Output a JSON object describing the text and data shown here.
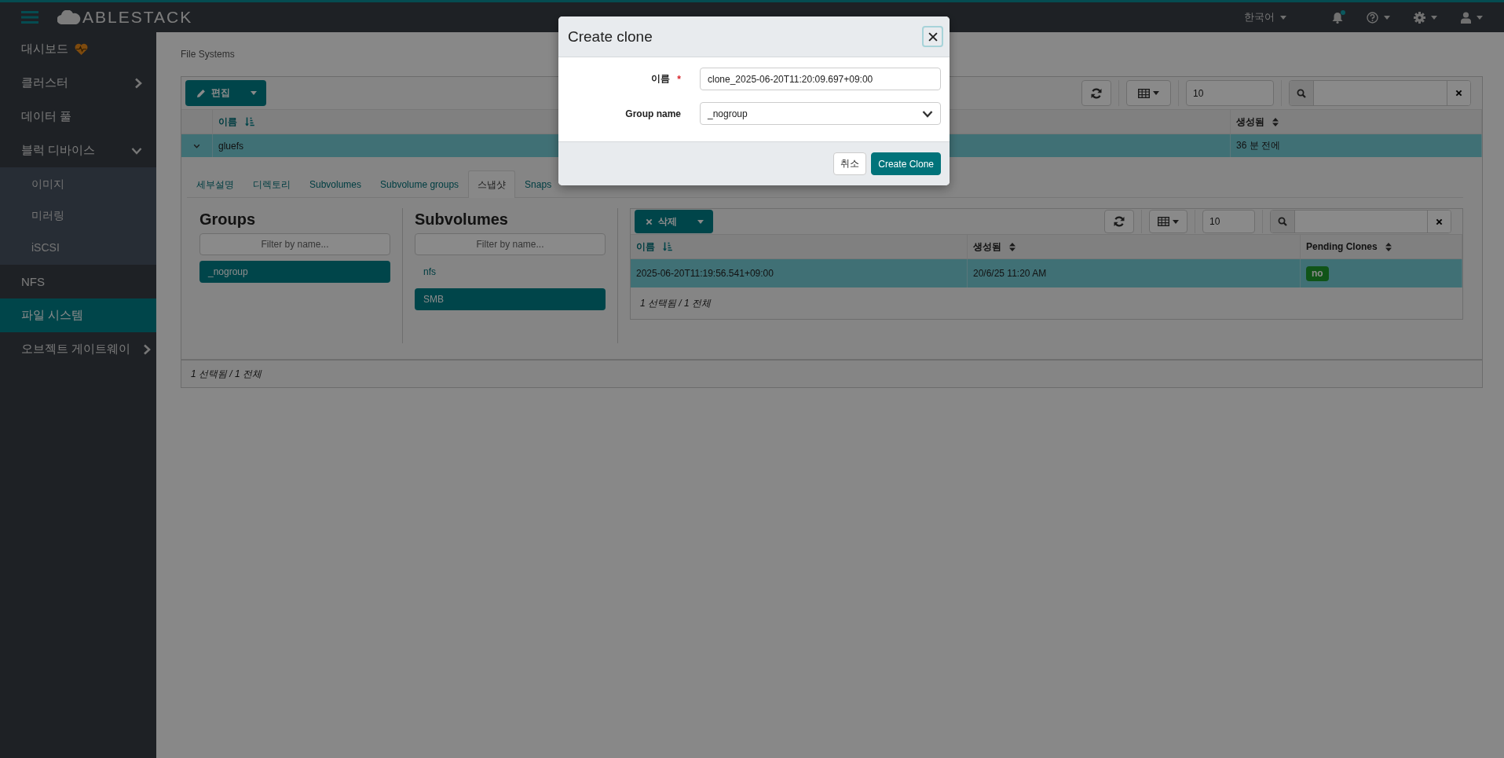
{
  "topbar": {
    "logo": "ABLESTACK",
    "language": "한국어",
    "notifications_unread": true
  },
  "sidebar": {
    "items": [
      {
        "label": "대시보드",
        "kind": "status",
        "selected": false
      },
      {
        "label": "클러스터",
        "kind": "menu",
        "selected": false,
        "expanded": false
      },
      {
        "label": "데이터 풀",
        "kind": "link",
        "selected": false
      },
      {
        "label": "블럭 디바이스",
        "kind": "menu",
        "selected": false,
        "expanded": true,
        "children": [
          {
            "label": "이미지",
            "selected": false
          },
          {
            "label": "미러링",
            "selected": false
          },
          {
            "label": "iSCSI",
            "selected": false
          }
        ]
      },
      {
        "label": "NFS",
        "kind": "link",
        "selected": false
      },
      {
        "label": "파일 시스템",
        "kind": "link",
        "selected": true
      },
      {
        "label": "오브젝트 게이트웨이",
        "kind": "menu",
        "selected": false,
        "expanded": false
      }
    ]
  },
  "breadcrumb": "File Systems",
  "file_systems": {
    "edit_button": "편집",
    "page_size": "10",
    "columns": [
      {
        "label": "이름",
        "sorted": true
      },
      {
        "label": "생성됨",
        "sorted": false
      }
    ],
    "rows": [
      {
        "cells": [
          "gluefs",
          "36 분 전에"
        ],
        "selected": true,
        "expanded": true
      }
    ],
    "footer": "1 선택됨 / 1 전체"
  },
  "detail": {
    "tabs": [
      {
        "label": "세부설명",
        "selected": false
      },
      {
        "label": "디렉토리",
        "selected": false
      },
      {
        "label": "Subvolumes",
        "selected": false
      },
      {
        "label": "Subvolume groups",
        "selected": false
      },
      {
        "label": "스냅샷",
        "selected": true
      },
      {
        "label": "Snaps",
        "selected": false
      }
    ],
    "groups": {
      "title": "Groups",
      "placeholder": "Filter by name...",
      "items": [
        {
          "label": "_nogroup",
          "selected": true
        }
      ]
    },
    "subvolumes": {
      "title": "Subvolumes",
      "placeholder": "Filter by name...",
      "items": [
        {
          "label": "nfs",
          "selected": false
        },
        {
          "label": "SMB",
          "selected": true
        }
      ]
    },
    "snapshots": {
      "delete_button": "삭제",
      "page_size": "10",
      "columns": [
        {
          "label": "이름",
          "sorted": true
        },
        {
          "label": "생성됨",
          "sorted": false
        },
        {
          "label": "Pending Clones",
          "sorted": false
        }
      ],
      "rows": [
        {
          "cells": [
            "2025-06-20T11:19:56.541+09:00",
            "20/6/25 11:20 AM"
          ],
          "pending_clones": "no",
          "selected": true
        }
      ],
      "footer": "1 선택됨 / 1 전체"
    }
  },
  "dialog": {
    "title": "Create clone",
    "fields": [
      {
        "label": "이름",
        "kind": "text",
        "required_mark": "*",
        "value": "clone_2025-06-20T11:20:09.697+09:00"
      },
      {
        "label": "Group name",
        "kind": "select",
        "value": "_nogroup"
      }
    ],
    "buttons": [
      {
        "label": "취소",
        "kind": "secondary"
      },
      {
        "label": "Create Clone",
        "kind": "primary"
      }
    ]
  }
}
